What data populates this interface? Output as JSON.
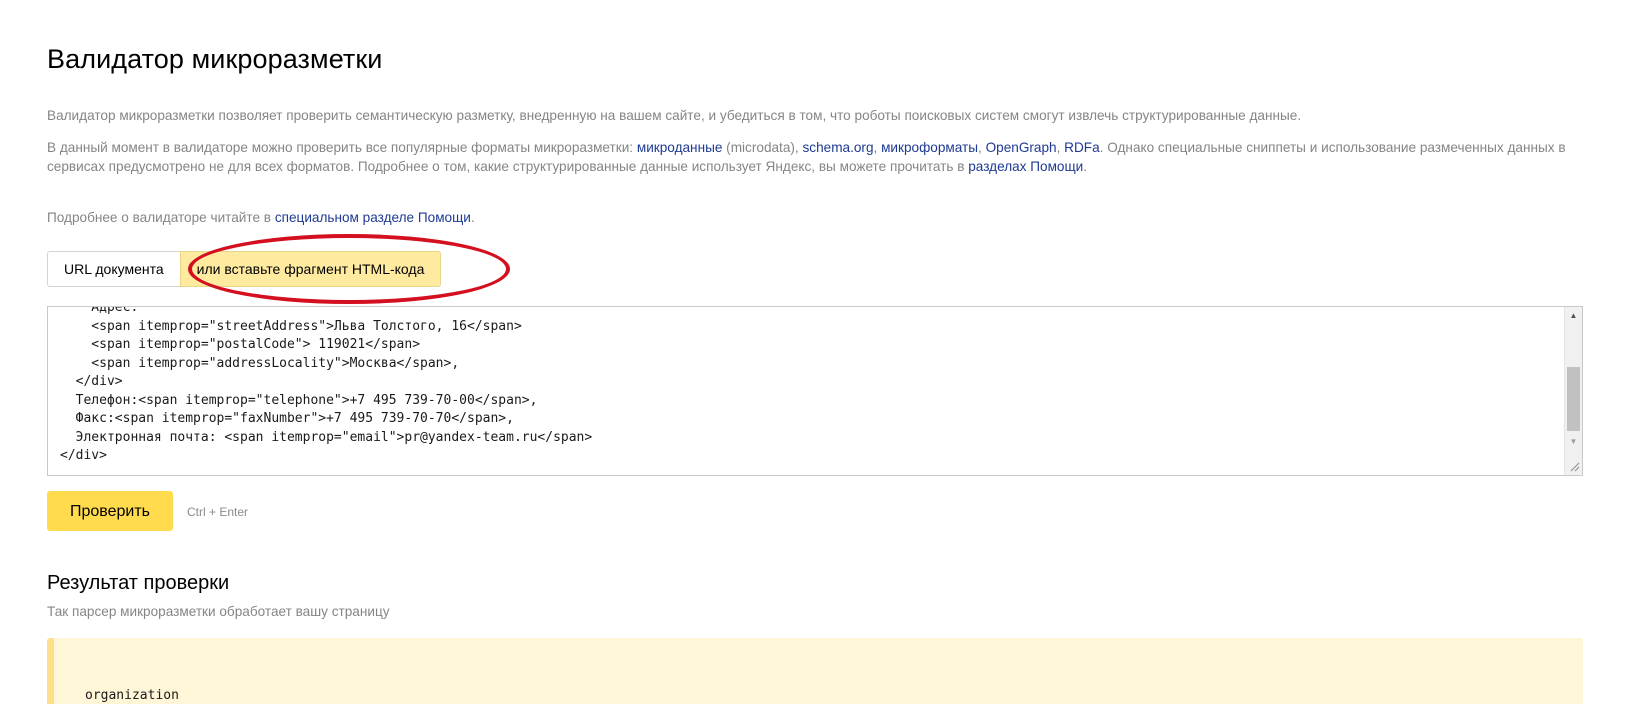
{
  "page": {
    "title": "Валидатор микроразметки"
  },
  "intro": {
    "p1": "Валидатор микроразметки позволяет проверить семантическую разметку, внедренную на вашем сайте, и убедиться в том, что роботы поисковых систем смогут извлечь структурированные данные.",
    "p2_start": "В данный момент в валидаторе можно проверить все популярные форматы микроразметки: ",
    "link_microdata": "микроданные",
    "p2_microdata_note": " (microdata), ",
    "link_schema": "schema.org",
    "sep1": ", ",
    "link_microformats": "микроформаты",
    "sep2": ", ",
    "link_opengraph": "OpenGraph",
    "sep3": ", ",
    "link_rdfa": "RDFa",
    "p2_mid": ". Однако специальные сниппеты и использование размеченных данных в сервисах предусмотрено не для всех форматов. Подробнее о том, какие структурированные данные использует Яндекс, вы можете прочитать в ",
    "link_help_sections": "разделах Помощи",
    "p2_end": ".",
    "p3_start": "Подробнее о валидаторе читайте в ",
    "link_help_special": "специальном разделе Помощи",
    "p3_end": "."
  },
  "tabs": [
    {
      "label": "URL документа",
      "active": false
    },
    {
      "label": "или вставьте фрагмент HTML-кода",
      "active": true
    }
  ],
  "editor": {
    "code": "    Адрес:\n    <span itemprop=\"streetAddress\">Льва Толстого, 16</span>\n    <span itemprop=\"postalCode\"> 119021</span>\n    <span itemprop=\"addressLocality\">Москва</span>,\n  </div>\n  Телефон:<span itemprop=\"telephone\">+7 495 739-70-00</span>,\n  Факс:<span itemprop=\"faxNumber\">+7 495 739-70-70</span>,\n  Электронная почта: <span itemprop=\"email\">pr@yandex-team.ru</span>\n</div>"
  },
  "actions": {
    "check_label": "Проверить",
    "hotkey": "Ctrl + Enter"
  },
  "result": {
    "title": "Результат проверки",
    "subtitle": "Так парсер микроразметки обработает вашу страницу",
    "first_item": "organization"
  },
  "colors": {
    "accent_button": "#ffdb4d",
    "active_tab": "#ffeba0",
    "link": "#1f3a93",
    "annotation_ring": "#d40f1f",
    "result_bg": "#fff5d7"
  },
  "icons": {
    "scroll_up": "▲",
    "scroll_down": "▼",
    "resize": "⁄⁄"
  }
}
